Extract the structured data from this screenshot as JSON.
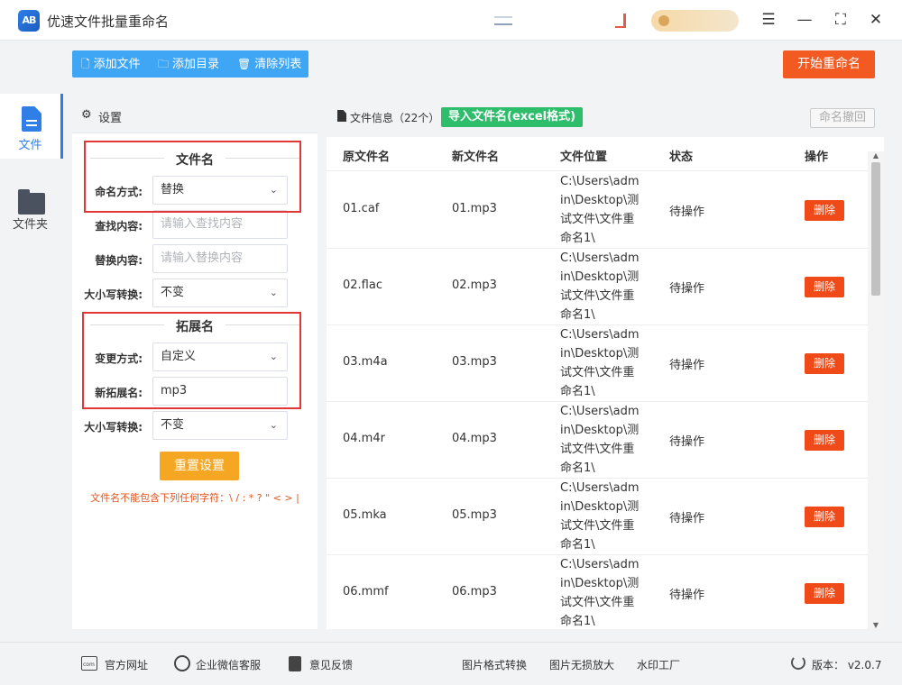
{
  "app": {
    "title": "优速文件批量重命名",
    "logo_text": "AB"
  },
  "window_controls": {
    "menu": "☰",
    "minimize": "—",
    "maximize": "⛶",
    "close": "✕"
  },
  "sidebar": {
    "items": [
      {
        "label": "文件",
        "icon": "file-icon",
        "active": true
      },
      {
        "label": "文件夹",
        "icon": "folder-icon",
        "active": false
      }
    ]
  },
  "toolbar": {
    "add_file": "添加文件",
    "add_dir": "添加目录",
    "clear_list": "清除列表",
    "start": "开始重命名"
  },
  "settings": {
    "header": "设置",
    "filename_section": "文件名",
    "naming_mode_label": "命名方式:",
    "naming_mode_value": "替换",
    "find_label": "查找内容:",
    "find_placeholder": "请输入查找内容",
    "replace_label": "替换内容:",
    "replace_placeholder": "请输入替换内容",
    "case_label": "大小写转换:",
    "case_value": "不变",
    "ext_section": "拓展名",
    "ext_mode_label": "变更方式:",
    "ext_mode_value": "自定义",
    "new_ext_label": "新拓展名:",
    "new_ext_value": "mp3",
    "ext_case_label": "大小写转换:",
    "ext_case_value": "不变",
    "reset_button": "重置设置",
    "warning": "文件名不能包含下列任何字符：\\ / : * ? \" < > |"
  },
  "file_panel": {
    "info_label": "文件信息（22个）",
    "import_button": "导入文件名(excel格式)",
    "undo_button": "命名撤回",
    "columns": [
      "原文件名",
      "新文件名",
      "文件位置",
      "状态",
      "操作"
    ],
    "rows": [
      {
        "original": "01.caf",
        "new": "01.mp3",
        "location": "C:\\Users\\admin\\Desktop\\测试文件\\文件重命名1\\",
        "status": "待操作",
        "action": "删除"
      },
      {
        "original": "02.flac",
        "new": "02.mp3",
        "location": "C:\\Users\\admin\\Desktop\\测试文件\\文件重命名1\\",
        "status": "待操作",
        "action": "删除"
      },
      {
        "original": "03.m4a",
        "new": "03.mp3",
        "location": "C:\\Users\\admin\\Desktop\\测试文件\\文件重命名1\\",
        "status": "待操作",
        "action": "删除"
      },
      {
        "original": "04.m4r",
        "new": "04.mp3",
        "location": "C:\\Users\\admin\\Desktop\\测试文件\\文件重命名1\\",
        "status": "待操作",
        "action": "删除"
      },
      {
        "original": "05.mka",
        "new": "05.mp3",
        "location": "C:\\Users\\admin\\Desktop\\测试文件\\文件重命名1\\",
        "status": "待操作",
        "action": "删除"
      },
      {
        "original": "06.mmf",
        "new": "06.mp3",
        "location": "C:\\Users\\admin\\Desktop\\测试文件\\文件重命名1\\",
        "status": "待操作",
        "action": "删除"
      }
    ]
  },
  "footer": {
    "website": "官方网址",
    "wechat": "企业微信客服",
    "feedback": "意见反馈",
    "img_convert": "图片格式转换",
    "img_upscale": "图片无损放大",
    "watermark": "水印工厂",
    "version": "版本：  v2.0.7"
  },
  "colors": {
    "accent_blue": "#3fa5f5",
    "start_orange": "#f25a22",
    "import_green": "#2ebd6b",
    "delete_red": "#f04a18",
    "reset_orange": "#f5a623",
    "highlight_red": "#e33636"
  }
}
